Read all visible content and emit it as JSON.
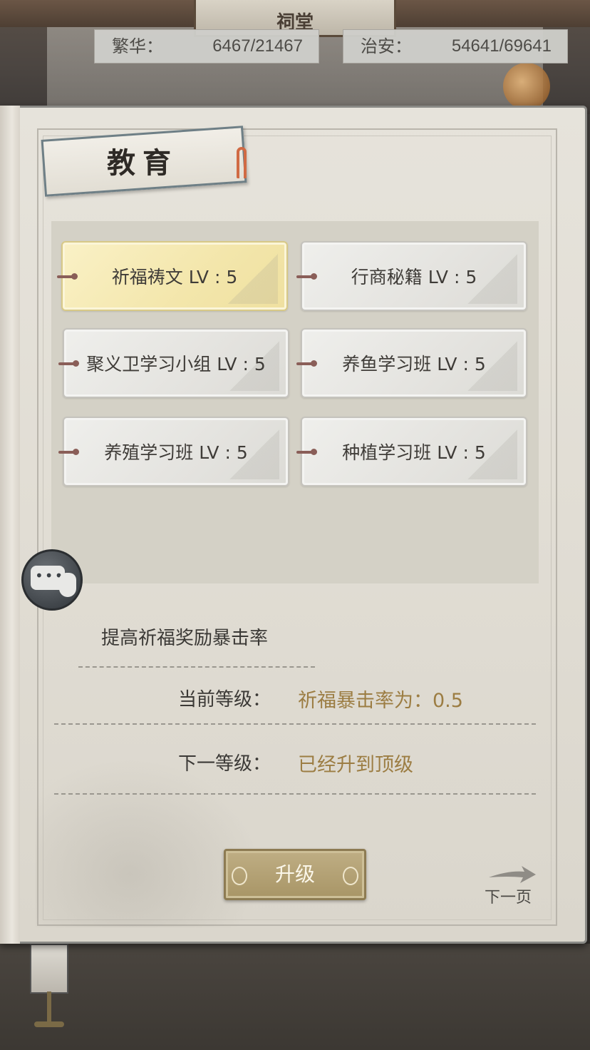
{
  "scene": {
    "sign_text": "祠堂"
  },
  "stats": {
    "fanhua": {
      "label": "繁华：",
      "value": "6467/21467"
    },
    "zhian": {
      "label": "治安：",
      "value": "54641/69641"
    }
  },
  "panel": {
    "title": "教育"
  },
  "skills": [
    {
      "label": "祈福祷文 LV : 5",
      "selected": true
    },
    {
      "label": "行商秘籍 LV : 5",
      "selected": false
    },
    {
      "label": "聚义卫学习小组 LV : 5",
      "selected": false
    },
    {
      "label": "养鱼学习班 LV : 5",
      "selected": false
    },
    {
      "label": "养殖学习班 LV : 5",
      "selected": false
    },
    {
      "label": "种植学习班 LV : 5",
      "selected": false
    }
  ],
  "detail": {
    "description": "提高祈福奖励暴击率",
    "current_label": "当前等级：",
    "current_value": "祈福暴击率为：0.5",
    "next_label": "下一等级：",
    "next_value": "已经升到顶级"
  },
  "actions": {
    "upgrade_label": "升级",
    "next_page_label": "下一页"
  },
  "colors": {
    "highlight": "#9c7d43",
    "selected_card": "#f3e6ab",
    "button": "#b3a173"
  }
}
